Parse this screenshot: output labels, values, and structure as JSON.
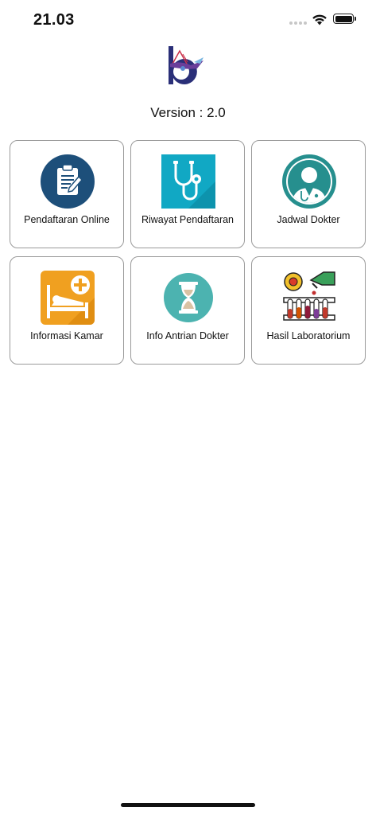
{
  "status_bar": {
    "time": "21.03",
    "icons": [
      "cellular-signal-icon",
      "wifi-icon",
      "battery-icon"
    ]
  },
  "app": {
    "logo": "hospital-logo",
    "version": "Version : 2.0"
  },
  "menu": [
    {
      "label": "Pendaftaran Online",
      "icon": "clipboard-icon"
    },
    {
      "label": "Riwayat Pendaftaran",
      "icon": "stethoscope-icon"
    },
    {
      "label": "Jadwal Dokter",
      "icon": "doctor-icon"
    },
    {
      "label": "Informasi Kamar",
      "icon": "hospital-bed-icon"
    },
    {
      "label": "Info Antrian Dokter",
      "icon": "hourglass-icon"
    },
    {
      "label": "Hasil Laboratorium",
      "icon": "lab-test-tubes-icon"
    }
  ],
  "colors": {
    "navy": "#1d4f7a",
    "teal": "#11a8c4",
    "teal_dark": "#268f8e",
    "orange": "#f0a020",
    "hourglass_bg": "#4cb3b0"
  }
}
